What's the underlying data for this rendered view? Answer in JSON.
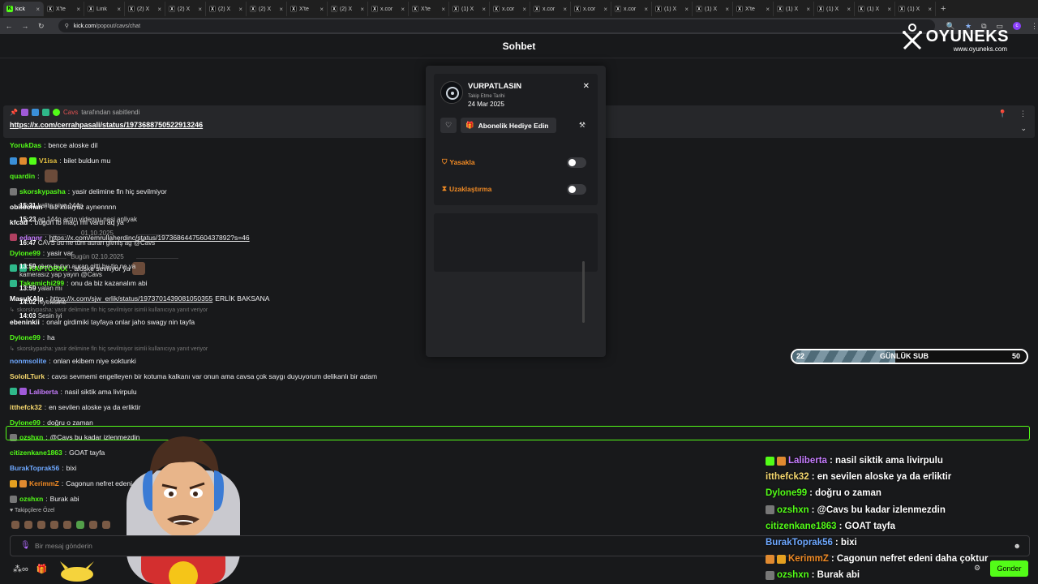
{
  "browser": {
    "tabs": [
      {
        "label": "kick",
        "icon": "kick-icon",
        "active": true
      },
      {
        "label": "X'te",
        "icon": "x-icon"
      },
      {
        "label": "Link",
        "icon": "link-icon"
      },
      {
        "label": "(2) X",
        "icon": "x-icon"
      },
      {
        "label": "(2) X",
        "icon": "x-icon"
      },
      {
        "label": "(2) X",
        "icon": "x-icon"
      },
      {
        "label": "(2) X",
        "icon": "x-icon"
      },
      {
        "label": "X'te",
        "icon": "x-icon"
      },
      {
        "label": "(2) X",
        "icon": "x-icon"
      },
      {
        "label": "x.cor",
        "icon": "x-icon"
      },
      {
        "label": "X'te",
        "icon": "x-icon"
      },
      {
        "label": "(1) X",
        "icon": "x-icon"
      },
      {
        "label": "x.cor",
        "icon": "x-icon"
      },
      {
        "label": "x.cor",
        "icon": "x-icon"
      },
      {
        "label": "x.cor",
        "icon": "x-icon"
      },
      {
        "label": "x.cor",
        "icon": "x-icon"
      },
      {
        "label": "(1) X",
        "icon": "x-icon"
      },
      {
        "label": "(1) X",
        "icon": "x-icon"
      },
      {
        "label": "X'te",
        "icon": "x-icon"
      },
      {
        "label": "(1) X",
        "icon": "x-icon"
      },
      {
        "label": "(1) X",
        "icon": "x-icon"
      },
      {
        "label": "(1) X",
        "icon": "x-icon"
      },
      {
        "label": "(1) X",
        "icon": "x-icon"
      }
    ],
    "url_domain": "kick.com",
    "url_path": "/popout/cavs/chat",
    "profile_letter": "c"
  },
  "header": {
    "title": "Sohbet"
  },
  "logo": {
    "name": "OYUNEKS",
    "site": "www.oyuneks.com"
  },
  "pinned": {
    "author": "Cavs",
    "suffix": "tarafından sabitlendi",
    "link": "https://x.com/cerrahpasali/status/1973688750522913246"
  },
  "chat": [
    {
      "user": "YorukDas",
      "color": "#53fc18",
      "text": "bence aloske dil",
      "badges": []
    },
    {
      "user": "V1isa",
      "color": "#e5c040",
      "text": "bilet buldun mu",
      "badges": [
        "#3a8fd8",
        "#e08a30",
        "#53fc18"
      ]
    },
    {
      "user": "quardin",
      "color": "#53fc18",
      "text": "",
      "badges": [],
      "emote": true
    },
    {
      "user": "skorskypasha",
      "color": "#53fc18",
      "text": "yasir delimine fln hiç sevilmiyor",
      "badges": [
        "#777"
      ]
    },
    {
      "user": "obitochan",
      "color": "#ffffff",
      "text": "biz kötüyüz aynennnn",
      "badges": []
    },
    {
      "user": "kfcad",
      "color": "#ffffff",
      "text": "bugün fb maçı mı vardı aq ya",
      "badges": []
    },
    {
      "user": "edannr",
      "color": "#c77dff",
      "text": "https://x.com/emrullaherdinc/status/1973686447560437892?s=46",
      "badges": [
        "#b04060"
      ],
      "link": true
    },
    {
      "user": "Dylone99",
      "color": "#53fc18",
      "text": "yasir var",
      "badges": []
    },
    {
      "user": "KAPTORXX",
      "color": "#53fc18",
      "text": "aloske seviliyor ya",
      "badges": [
        "#2fb88a",
        "#2fb88a"
      ],
      "emote": true
    },
    {
      "user": "Takemichi299",
      "color": "#53fc18",
      "text": "onu da biz kazanalım abi",
      "badges": [
        "#2fb88a"
      ]
    },
    {
      "user": "MasuKAlp",
      "color": "#ffffff",
      "text": "https://x.com/sjw_erlik/status/1973701439081050355",
      "suffix": "ERLİK BAKSANA",
      "badges": [],
      "link": true
    },
    {
      "reply": "skorskypasha: yasir delimine fln hiç sevilmiyor isimli kullanıcıya yanıt veriyor"
    },
    {
      "user": "ebeninkii",
      "color": "#ffffff",
      "text": "onalr girdimiki tayfaya onlar jaho swagy nin tayfa",
      "badges": []
    },
    {
      "user": "Dylone99",
      "color": "#53fc18",
      "text": "ha",
      "badges": []
    },
    {
      "reply": "skorskypasha: yasir delimine fln hiç sevilmiyor isimli kullanıcıya yanıt veriyor"
    },
    {
      "user": "nonmsolite",
      "color": "#6ea8ff",
      "text": "onlan ekibem niye soktunki",
      "badges": []
    },
    {
      "user": "SoloILTurk",
      "color": "#f5d76e",
      "text": "cavsı sevmemi engelleyen bir kotuma kalkanı var onun ama cavsa çok saygı duyuyorum delikanlı bir adam",
      "badges": []
    },
    {
      "user": "Laliberta",
      "color": "#c77dff",
      "text": "nasil siktik ama livirpulu",
      "badges": [
        "#2fb88a",
        "#a05ad8"
      ]
    },
    {
      "user": "itthefck32",
      "color": "#f5d76e",
      "text": "en sevilen aloske ya da erliktir",
      "badges": []
    },
    {
      "user": "Dylone99",
      "color": "#53fc18",
      "text": "doğru o zaman",
      "badges": []
    },
    {
      "user": "ozshxn",
      "color": "#53fc18",
      "text": "@Cavs bu kadar izlenmezdin",
      "badges": [
        "#777"
      ],
      "highlight": true
    },
    {
      "user": "citizenkane1863",
      "color": "#53fc18",
      "text": "GOAT tayfa",
      "badges": []
    },
    {
      "user": "BurakToprak56",
      "color": "#6ea8ff",
      "text": "bixi",
      "badges": []
    },
    {
      "user": "KerimmZ",
      "color": "#f08a24",
      "text": "Cagonun nefret edeni daha çoktur",
      "badges": [
        "#e5a020",
        "#e08a30"
      ]
    },
    {
      "user": "ozshxn",
      "color": "#53fc18",
      "text": "Burak abi",
      "badges": [
        "#777"
      ]
    }
  ],
  "followers_label": "Takipçilere Özel",
  "input": {
    "placeholder": "Bir mesaj gönderin",
    "send": "Gonder"
  },
  "popup": {
    "name": "VURPATLASIN",
    "follow_label": "Takip Etme Tarihi",
    "follow_date": "24 Mar 2025",
    "gift_label": "Abonelik Hediye Edin",
    "ban_label": "Yasakla",
    "timeout_label": "Uzaklaştırma",
    "history": [
      {
        "time": "15:21",
        "text": "kalite niye 144p"
      },
      {
        "time": "15:23",
        "text": "ag 144p actın videoyu nasi anliyak"
      },
      {
        "sep": "01.10.2025"
      },
      {
        "time": "16:47",
        "text": "CAVS bu ne tüm auran gitmiş ag @Cavs"
      },
      {
        "sep": "Bugün 02.10.2025"
      },
      {
        "time": "13:59",
        "text": "olum butun auran gitti bu tip ne ya kamerasız yap yayın @Cavs"
      },
      {
        "time": "13:59",
        "text": "yalan mı"
      },
      {
        "time": "14:02",
        "text": "niyekisine"
      },
      {
        "time": "14:03",
        "text": "Sesin iyi"
      }
    ]
  },
  "progress": {
    "current": "22",
    "label": "GÜNLÜK SUB",
    "target": "50",
    "fraction": 0.44
  },
  "overlay": [
    {
      "user": "Laliberta",
      "color": "#c77dff",
      "text": ": nasil siktik ama livirpulu",
      "badges": [
        "#53fc18",
        "#e08a30"
      ]
    },
    {
      "user": "itthefck32",
      "color": "#f5d76e",
      "text": ": en sevilen aloske ya da erliktir",
      "badges": []
    },
    {
      "user": "Dylone99",
      "color": "#53fc18",
      "text": ": doğru o zaman",
      "badges": []
    },
    {
      "user": "ozshxn",
      "color": "#53fc18",
      "text": ": @Cavs bu kadar izlenmezdin",
      "badges": [
        "#777"
      ]
    },
    {
      "user": "citizenkane1863",
      "color": "#53fc18",
      "text": ": GOAT tayfa",
      "badges": []
    },
    {
      "user": "BurakToprak56",
      "color": "#6ea8ff",
      "text": ": bixi",
      "badges": []
    },
    {
      "user": "KerimmZ",
      "color": "#f08a24",
      "text": ": Cagonun nefret edeni daha çoktur",
      "badges": [
        "#e08a30",
        "#e5a020"
      ]
    },
    {
      "user": "ozshxn",
      "color": "#53fc18",
      "text": ": Burak abi",
      "badges": [
        "#777"
      ]
    }
  ]
}
